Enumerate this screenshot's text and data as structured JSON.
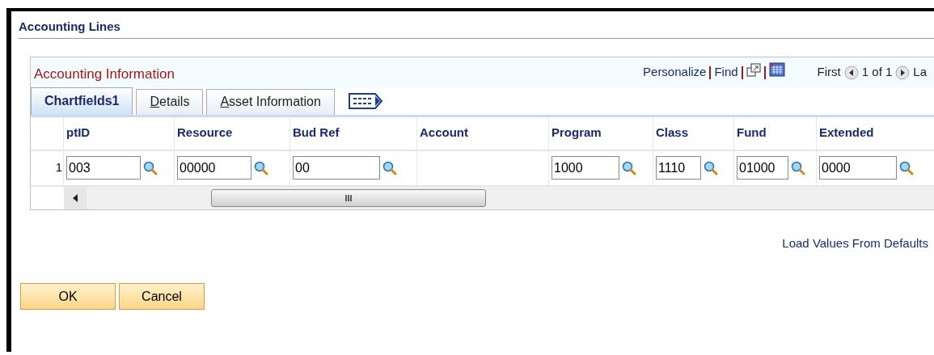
{
  "page_title": "Accounting Lines",
  "grid": {
    "title": "Accounting Information",
    "toolbar": {
      "links": [
        "Personalize",
        "Find"
      ],
      "first": "First",
      "count": "1 of 1",
      "last": "La"
    },
    "tabs": [
      {
        "label": "Chartfields1",
        "selected": true,
        "underline_first": false
      },
      {
        "label": "Details",
        "selected": false,
        "underline_first": true
      },
      {
        "label": "Asset Information",
        "selected": false,
        "underline_first": true
      }
    ],
    "columns": [
      "ptID",
      "Resource",
      "Bud Ref",
      "Account",
      "Program",
      "Class",
      "Fund",
      "Extended"
    ],
    "rows": [
      {
        "number": "1",
        "cells": [
          {
            "kind": "lookup",
            "value": "003"
          },
          {
            "kind": "lookup",
            "value": "00000"
          },
          {
            "kind": "lookup",
            "value": "00"
          },
          {
            "kind": "empty"
          },
          {
            "kind": "lookup",
            "value": "1000"
          },
          {
            "kind": "lookup",
            "value": "1110"
          },
          {
            "kind": "lookup",
            "value": "01000"
          },
          {
            "kind": "lookup",
            "value": "0000"
          }
        ]
      }
    ]
  },
  "load_defaults_link": "Load Values From Defaults",
  "buttons": [
    "OK",
    "Cancel"
  ]
}
